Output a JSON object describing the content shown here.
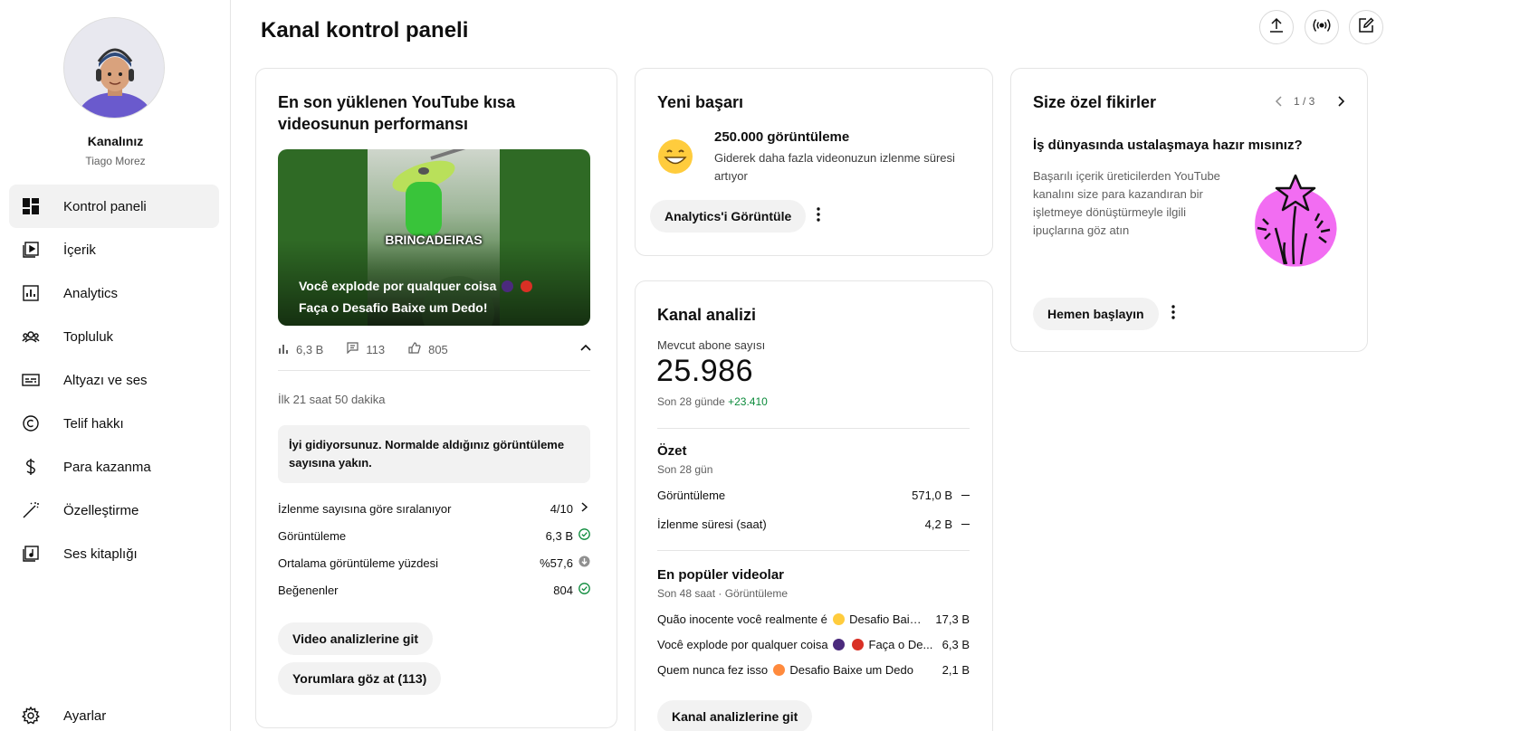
{
  "sidebar": {
    "channel_name": "Kanalınız",
    "channel_handle": "Tiago Morez",
    "items": [
      {
        "label": "Kontrol paneli",
        "icon": "dashboard-icon",
        "active": true
      },
      {
        "label": "İçerik",
        "icon": "content-icon"
      },
      {
        "label": "Analytics",
        "icon": "analytics-icon"
      },
      {
        "label": "Topluluk",
        "icon": "community-icon"
      },
      {
        "label": "Altyazı ve ses",
        "icon": "subtitles-icon"
      },
      {
        "label": "Telif hakkı",
        "icon": "copyright-icon"
      },
      {
        "label": "Para kazanma",
        "icon": "dollar-icon"
      },
      {
        "label": "Özelleştirme",
        "icon": "magic-wand-icon"
      },
      {
        "label": "Ses kitaplığı",
        "icon": "audio-library-icon"
      }
    ],
    "settings_label": "Ayarlar"
  },
  "header": {
    "title": "Kanal kontrol paneli",
    "actions": [
      "upload-icon",
      "live-icon",
      "create-post-icon"
    ]
  },
  "short_card": {
    "title": "En son yüklenen YouTube kısa videosunun performansı",
    "thumb_word": "BRINCADEIRAS",
    "thumb_title_line1": "Você explode por qualquer coisa",
    "thumb_title_line2": "Faça o Desafio Baixe um Dedo!",
    "views": "6,3 B",
    "comments": "113",
    "likes": "805",
    "period": "İlk 21 saat 50 dakika",
    "message": "İyi gidiyorsunuz. Normalde aldığınız görüntüleme sayısına yakın.",
    "rows": [
      {
        "label": "İzlenme sayısına göre sıralanıyor",
        "value": "4/10",
        "icon": "chevron-right-icon"
      },
      {
        "label": "Görüntüleme",
        "value": "6,3 B",
        "icon": "check-circle-icon"
      },
      {
        "label": "Ortalama görüntüleme yüzdesi",
        "value": "%57,6",
        "icon": "arrow-down-circle-icon"
      },
      {
        "label": "Beğenenler",
        "value": "804",
        "icon": "check-circle-icon"
      }
    ],
    "button_analytics": "Video analizlerine git",
    "button_comments": "Yorumlara göz at (113)"
  },
  "achievement_card": {
    "title": "Yeni başarı",
    "headline": "250.000 görüntüleme",
    "body": "Giderek daha fazla videonuzun izlenme süresi artıyor",
    "button": "Analytics'i Görüntüle"
  },
  "analysis_card": {
    "title": "Kanal analizi",
    "subs_label": "Mevcut abone sayısı",
    "subs_value": "25.986",
    "subs_period": "Son 28 günde",
    "subs_delta": "+23.410",
    "summary_title": "Özet",
    "summary_period": "Son 28 gün",
    "summary_rows": [
      {
        "label": "Görüntüleme",
        "value": "571,0 B"
      },
      {
        "label": "İzlenme süresi (saat)",
        "value": "4,2 B"
      }
    ],
    "top_title": "En popüler videolar",
    "top_period": "Son 48 saat · Görüntüleme",
    "top_rows": [
      {
        "pre": "Quão inocente você realmente é",
        "post": "Desafio Baixe...",
        "value": "17,3 B"
      },
      {
        "pre": "Você explode por qualquer coisa",
        "post": "Faça o De...",
        "value": "6,3 B"
      },
      {
        "pre": "Quem nunca fez isso",
        "post": "Desafio Baixe um Dedo",
        "value": "2,1 B"
      }
    ],
    "button": "Kanal analizlerine git"
  },
  "ideas_card": {
    "title": "Size özel fikirler",
    "pager": "1 / 3",
    "headline": "İş dünyasında ustalaşmaya hazır mısınız?",
    "body": "Başarılı içerik üreticilerden YouTube kanalını size para kazandıran bir işletmeye dönüştürmeyle ilgili ipuçlarına göz atın",
    "button": "Hemen başlayın"
  },
  "colors": {
    "accent_green": "#0b8a3a",
    "card_border": "#e5e5e5",
    "pill_bg": "#f2f2f2",
    "idea_pink": "#f26df2"
  }
}
